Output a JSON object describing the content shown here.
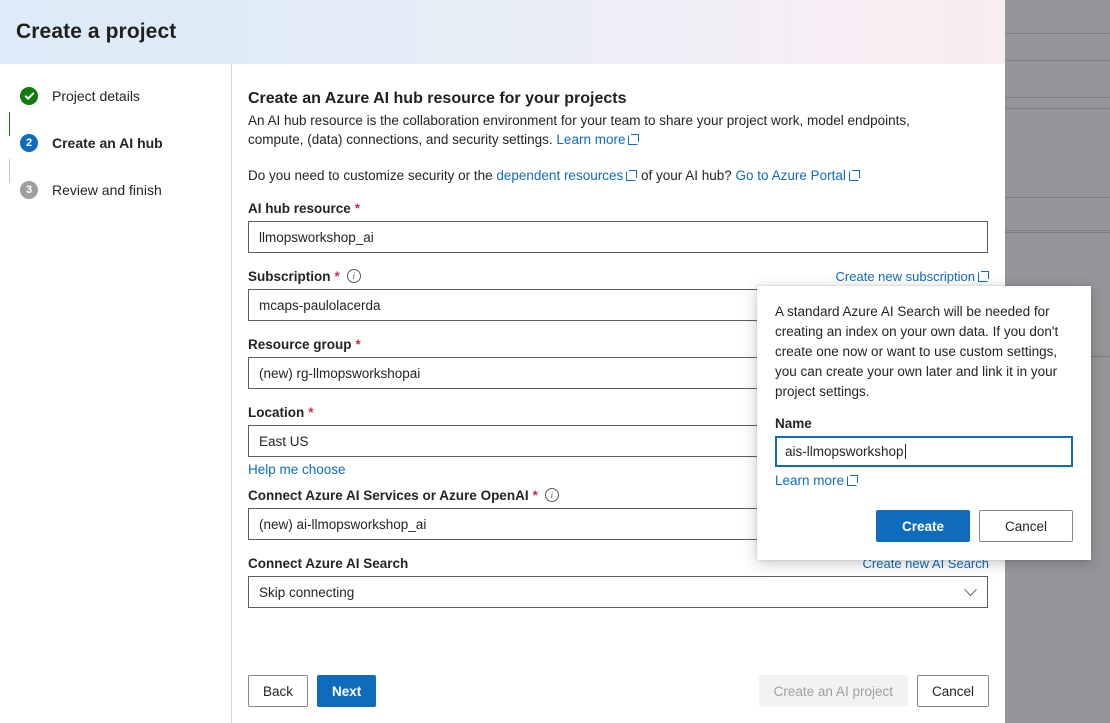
{
  "backdrop": {
    "color": "#96969a"
  },
  "dialog": {
    "title": "Create a project",
    "header_gradient_start": "#dcebf7",
    "header_gradient_end": "#f9ecf2"
  },
  "wizard": {
    "steps": [
      {
        "marker": "check",
        "label": "Project details",
        "state": "done"
      },
      {
        "marker": "2",
        "label": "Create an AI hub",
        "state": "current"
      },
      {
        "marker": "3",
        "label": "Review and finish",
        "state": "todo"
      }
    ]
  },
  "pane": {
    "title": "Create an Azure AI hub resource for your projects",
    "description_part1": "An AI hub resource is the collaboration environment for your team to share your project work, model endpoints, compute, (data) connections, and security settings. ",
    "description_link": "Learn more",
    "security_part1": "Do you need to customize security or the ",
    "security_link1": "dependent resources",
    "security_part2": " of your AI hub? ",
    "security_link2": "Go to Azure Portal"
  },
  "form": {
    "fields": [
      {
        "label": "AI hub resource",
        "required": true,
        "info": false,
        "value": "llmopsworkshop_ai",
        "dropdown": false,
        "side_link": "",
        "sub_link": ""
      },
      {
        "label": "Subscription",
        "required": true,
        "info": true,
        "value": "mcaps-paulolacerda",
        "dropdown": true,
        "side_link": "Create new subscription",
        "side_link_external": true,
        "sub_link": ""
      },
      {
        "label": "Resource group",
        "required": true,
        "info": false,
        "value": "(new) rg-llmopsworkshopai",
        "dropdown": true,
        "side_link": "",
        "sub_link": ""
      },
      {
        "label": "Location",
        "required": true,
        "info": false,
        "value": "East US",
        "dropdown": true,
        "side_link": "",
        "sub_link": "Help me choose"
      },
      {
        "label": "Connect Azure AI Services or Azure OpenAI",
        "required": true,
        "info": true,
        "value": "(new) ai-llmopsworkshop_ai",
        "dropdown": true,
        "side_link": "",
        "sub_link": ""
      },
      {
        "label": "Connect Azure AI Search",
        "required": false,
        "info": false,
        "value": "Skip connecting",
        "dropdown": true,
        "side_link": "Create new AI Search",
        "side_link_external": false,
        "sub_link": ""
      }
    ]
  },
  "footer": {
    "back_label": "Back",
    "next_label": "Next",
    "create_project_label": "Create an AI project",
    "cancel_label": "Cancel"
  },
  "callout": {
    "body": "A standard Azure AI Search will be needed for creating an index on your own data. If you don't create one now or want to use custom settings, you can create your own later and link it in your project settings.",
    "name_label": "Name",
    "name_value": "ais-llmopsworkshop",
    "learn_more": "Learn more",
    "create_label": "Create",
    "cancel_label": "Cancel",
    "accent_color": "#0f6cbd"
  }
}
